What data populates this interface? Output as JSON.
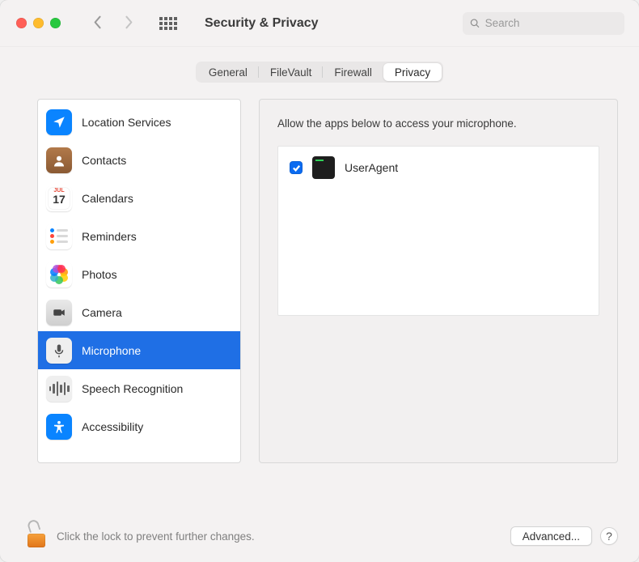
{
  "window": {
    "title": "Security & Privacy"
  },
  "search": {
    "placeholder": "Search"
  },
  "tabs": [
    {
      "label": "General",
      "active": false
    },
    {
      "label": "FileVault",
      "active": false
    },
    {
      "label": "Firewall",
      "active": false
    },
    {
      "label": "Privacy",
      "active": true
    }
  ],
  "sidebar": {
    "items": [
      {
        "id": "location",
        "label": "Location Services",
        "selected": false
      },
      {
        "id": "contacts",
        "label": "Contacts",
        "selected": false
      },
      {
        "id": "calendars",
        "label": "Calendars",
        "selected": false,
        "calendar_month": "JUL",
        "calendar_day": "17"
      },
      {
        "id": "reminders",
        "label": "Reminders",
        "selected": false
      },
      {
        "id": "photos",
        "label": "Photos",
        "selected": false
      },
      {
        "id": "camera",
        "label": "Camera",
        "selected": false
      },
      {
        "id": "microphone",
        "label": "Microphone",
        "selected": true
      },
      {
        "id": "speech",
        "label": "Speech Recognition",
        "selected": false
      },
      {
        "id": "accessibility",
        "label": "Accessibility",
        "selected": false
      }
    ]
  },
  "detail": {
    "heading": "Allow the apps below to access your microphone.",
    "apps": [
      {
        "name": "UserAgent",
        "checked": true
      }
    ]
  },
  "footer": {
    "lock_text": "Click the lock to prevent further changes.",
    "advanced_label": "Advanced...",
    "help_label": "?"
  }
}
